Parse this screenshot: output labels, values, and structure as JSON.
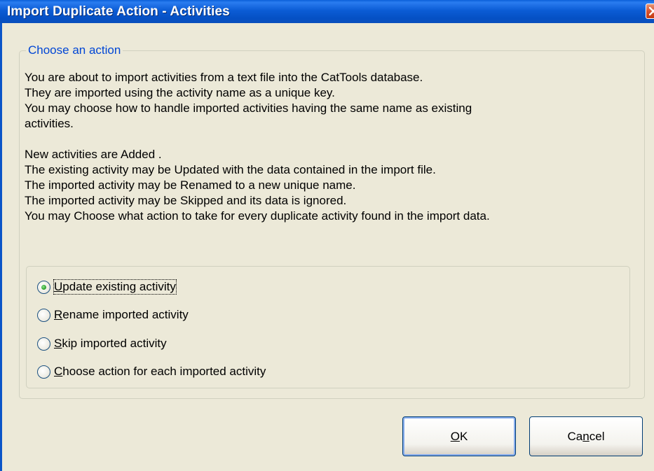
{
  "window": {
    "title": "Import Duplicate Action - Activities",
    "close_icon": "close-x-icon",
    "titlebar_color": "#0a5fd8",
    "close_color": "#d8532f"
  },
  "group": {
    "legend": "Choose an action",
    "legend_color": "#0046d5"
  },
  "description": [
    "You are about to import activities from a text file into the CatTools database.",
    "They are imported using the activity name as a unique key.",
    "You may choose how to handle imported activities having the same name as existing",
    "activities.",
    "",
    "New activities are  Added .",
    "The existing activity may be  Updated  with the data contained in the import file.",
    "The imported activity may be  Renamed  to a new unique name.",
    "The imported activity may be  Skipped  and its data is ignored.",
    "You may  Choose  what action to take for every duplicate activity found in the import data."
  ],
  "options": [
    {
      "mnemonic": "U",
      "rest": "pdate  existing activity",
      "selected": true
    },
    {
      "mnemonic": "R",
      "rest": "ename  imported activity",
      "selected": false
    },
    {
      "mnemonic": "S",
      "rest": "kip imported activity",
      "selected": false
    },
    {
      "mnemonic": "C",
      "rest": "hoose  action for each imported activity",
      "selected": false
    }
  ],
  "buttons": {
    "ok": {
      "mnemonic": "O",
      "rest": "K"
    },
    "cancel": {
      "pre": "Ca",
      "mnemonic": "n",
      "rest": "cel"
    }
  }
}
